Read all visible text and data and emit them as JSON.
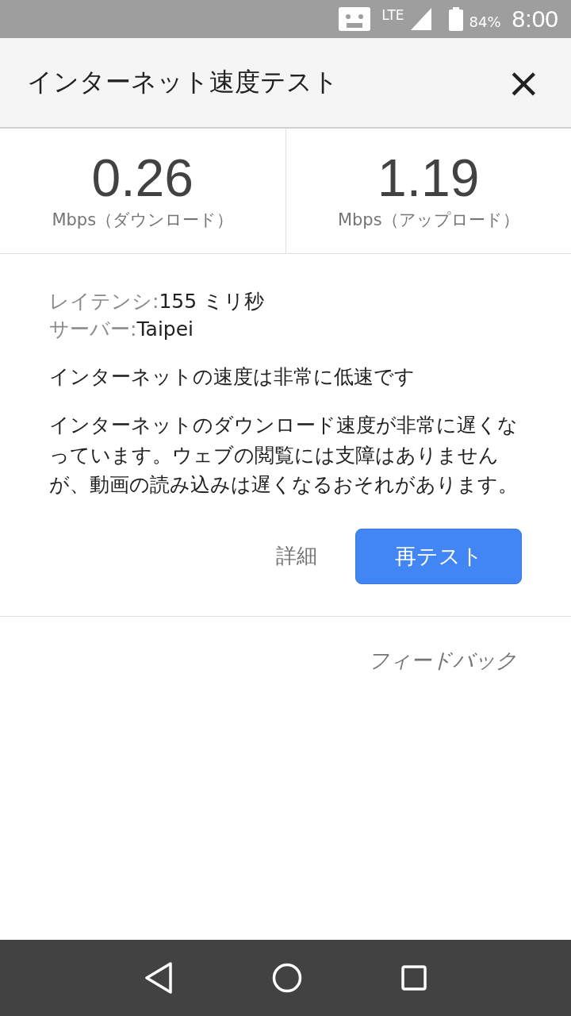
{
  "status_bar": {
    "network": "LTE",
    "battery": "84%",
    "time": "8:00"
  },
  "header": {
    "title": "インターネット速度テスト",
    "close": "×"
  },
  "results": [
    {
      "value": "0.26",
      "unit": "Mbps（ダウンロード）"
    },
    {
      "value": "1.19",
      "unit": "Mbps（アップロード）"
    }
  ],
  "details": [
    {
      "label": "レイテンシ:",
      "value": "155 ミリ秒"
    },
    {
      "label": "サーバー:",
      "value": "Taipei"
    }
  ],
  "summary": "インターネットの速度は非常に低速です",
  "description": "インターネットのダウンロード速度が非常に遅くなっています。ウェブの閲覧には支障はありませんが、動画の読み込みは遅くなるおそれがあります。",
  "buttons": {
    "details": "詳細",
    "retest": "再テスト"
  },
  "feedback": "フィードバック"
}
